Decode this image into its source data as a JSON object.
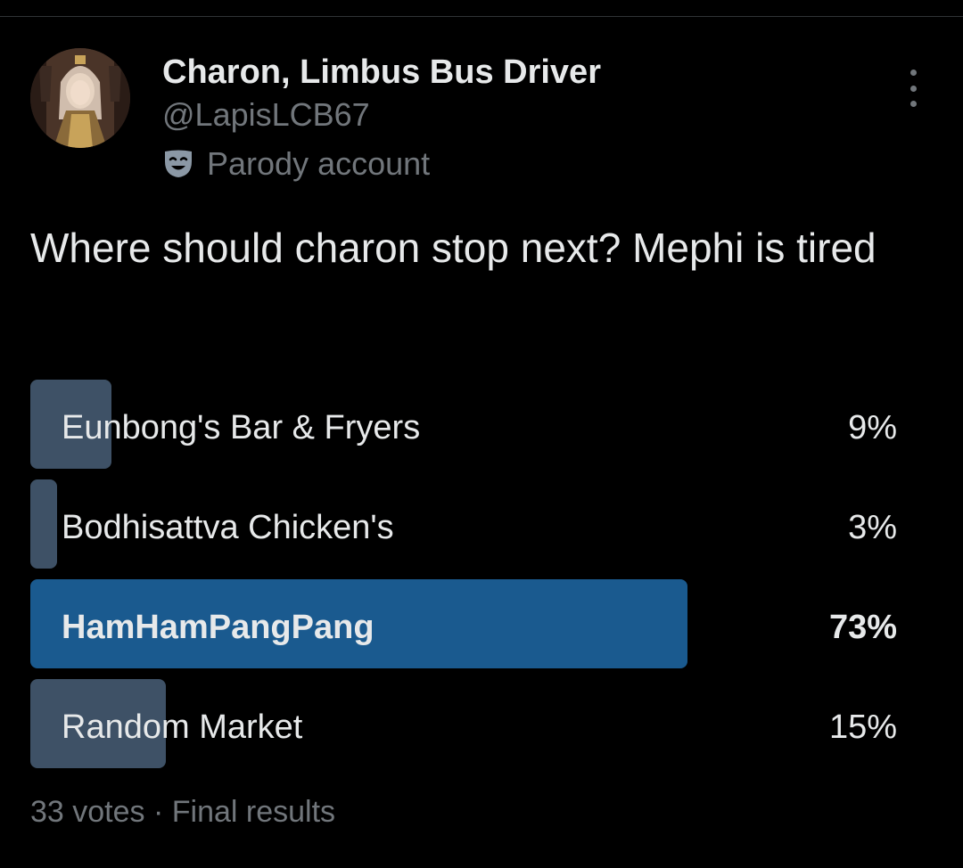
{
  "author": {
    "display_name": "Charon, Limbus Bus Driver",
    "handle": "@LapisLCB67",
    "label": "Parody account",
    "label_icon": "theater-mask-icon",
    "avatar": "character-avatar"
  },
  "menu": {
    "icon": "more-vertical-icon"
  },
  "tweet": {
    "text": "Where should charon stop next? Mephi is tired"
  },
  "poll": {
    "options": [
      {
        "label": "Eunbong's Bar & Fryers",
        "percent_text": "9%",
        "percent": 9,
        "winner": false
      },
      {
        "label": "Bodhisattva Chicken's",
        "percent_text": "3%",
        "percent": 3,
        "winner": false
      },
      {
        "label": "HamHamPangPang",
        "percent_text": "73%",
        "percent": 73,
        "winner": true
      },
      {
        "label": "Random Market",
        "percent_text": "15%",
        "percent": 15,
        "winner": false
      }
    ],
    "footer": "33 votes · Final results"
  },
  "colors": {
    "background": "#000000",
    "text_primary": "#e7e9ea",
    "text_secondary": "#71767b",
    "bar_default": "#3e5166",
    "bar_winner": "#1a5a8f"
  }
}
